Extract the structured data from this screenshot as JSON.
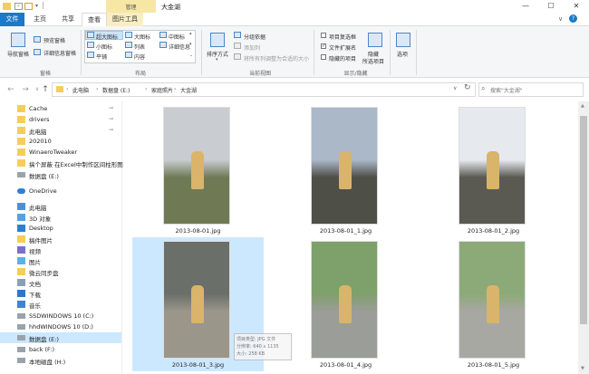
{
  "window": {
    "contextual_group": "管理",
    "title": "大金湖",
    "minimize_glyph": "—",
    "maximize_glyph": "☐",
    "close_glyph": "✕"
  },
  "tabs": [
    "文件",
    "主页",
    "共享",
    "查看",
    "图片工具"
  ],
  "ribbon": {
    "panes": {
      "nav_pane": "导航窗格",
      "preview_pane": "预览窗格",
      "details_pane": "详细信息窗格",
      "group": "窗格"
    },
    "layout": {
      "items": [
        "超大图标",
        "大图标",
        "中图标",
        "小图标",
        "列表",
        "详细信息",
        "平铺",
        "内容"
      ],
      "group": "布局"
    },
    "current_view": {
      "sort_by": "排序方式",
      "group_by": "分组依据",
      "add_columns": "添加列",
      "size_columns": "将所有列调整为合适的大小",
      "group": "当前视图"
    },
    "show_hide": {
      "item_checkboxes": "项目复选框",
      "file_extensions": "文件扩展名",
      "hidden_items": "隐藏的项目",
      "checked_mark": "✓",
      "hide": "隐藏",
      "selected_items": "所选项目",
      "group": "显示/隐藏"
    },
    "options": "选项"
  },
  "address": {
    "crumbs": [
      "此电脑",
      "数据盘 (E:)",
      "家庭照片",
      "大金湖"
    ],
    "search_placeholder": "搜索\"大金湖\""
  },
  "nav": {
    "items": [
      {
        "label": "Cache",
        "icon": "folder-icon",
        "pinned": true
      },
      {
        "label": "drivers",
        "icon": "folder-icon",
        "pinned": true
      },
      {
        "label": "此电脑",
        "icon": "folder-icon",
        "pinned": true
      },
      {
        "label": "202010",
        "icon": "folder-icon",
        "pinned": false
      },
      {
        "label": "WinaeroTweaker",
        "icon": "folder-icon",
        "pinned": false
      },
      {
        "label": "搞个屏蔽 在Excel中制作区间柱形图",
        "icon": "folder-icon",
        "pinned": false
      },
      {
        "label": "数据盘 (E:)",
        "icon": "drive-icon",
        "pinned": false
      },
      {
        "label": "OneDrive",
        "icon": "cloud-icon",
        "pinned": false
      },
      {
        "label": "此电脑",
        "icon": "computer-icon",
        "pinned": false
      },
      {
        "label": "3D 对象",
        "icon": "cube-icon",
        "pinned": false
      },
      {
        "label": "Desktop",
        "icon": "desktop-icon",
        "pinned": false
      },
      {
        "label": "稿件图片",
        "icon": "folder-icon",
        "pinned": false
      },
      {
        "label": "视频",
        "icon": "video-icon",
        "pinned": false
      },
      {
        "label": "图片",
        "icon": "pictures-icon",
        "pinned": false
      },
      {
        "label": "微云同步盘",
        "icon": "folder-icon",
        "pinned": false
      },
      {
        "label": "文档",
        "icon": "documents-icon",
        "pinned": false
      },
      {
        "label": "下载",
        "icon": "download-icon",
        "pinned": false
      },
      {
        "label": "音乐",
        "icon": "music-icon",
        "pinned": false
      },
      {
        "label": "SSDWINDOWS 10 (C:)",
        "icon": "drive-icon",
        "pinned": false
      },
      {
        "label": "hhdWINDOWS 10 (D:)",
        "icon": "drive-icon",
        "pinned": false
      },
      {
        "label": "数据盘 (E:)",
        "icon": "drive-icon",
        "pinned": false,
        "selected": true
      },
      {
        "label": "back (F:)",
        "icon": "drive-icon",
        "pinned": false
      },
      {
        "label": "本地磁盘 (H:)",
        "icon": "drive-icon",
        "pinned": false
      }
    ],
    "pin_glyph": "📌"
  },
  "files": [
    {
      "name": "2013-08-01.jpg",
      "selected": false,
      "sky": "#c9ccd0",
      "ground": "#6f7a55"
    },
    {
      "name": "2013-08-01_1.jpg",
      "selected": false,
      "sky": "#aab8c8",
      "ground": "#4e4f47"
    },
    {
      "name": "2013-08-01_2.jpg",
      "selected": false,
      "sky": "#e6eaef",
      "ground": "#5a5a52"
    },
    {
      "name": "2013-08-01_3.jpg",
      "selected": true,
      "sky": "#6b6f6a",
      "ground": "#9a968a"
    },
    {
      "name": "2013-08-01_4.jpg",
      "selected": false,
      "sky": "#7ea06a",
      "ground": "#9b9d98"
    },
    {
      "name": "2013-08-01_5.jpg",
      "selected": false,
      "sky": "#8caa78",
      "ground": "#a8a8a2"
    }
  ],
  "tooltip": {
    "line1": "项目类型: JPG 文件",
    "line2": "分辨率: 640 x 1135",
    "line3": "大小: 258 KB"
  }
}
